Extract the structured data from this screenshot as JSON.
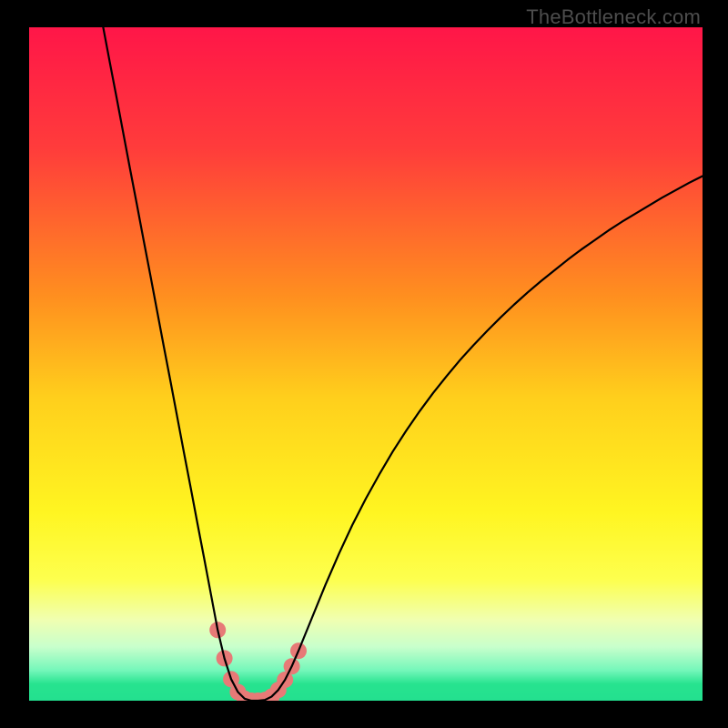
{
  "watermark": "TheBottleneck.com",
  "chart_data": {
    "type": "line",
    "title": "",
    "xlabel": "",
    "ylabel": "",
    "xlim": [
      0,
      100
    ],
    "ylim": [
      0,
      100
    ],
    "gradient_stops": [
      {
        "pos": 0.0,
        "color": "#ff1648"
      },
      {
        "pos": 0.18,
        "color": "#ff3c3b"
      },
      {
        "pos": 0.4,
        "color": "#ff8f1f"
      },
      {
        "pos": 0.55,
        "color": "#ffcf1c"
      },
      {
        "pos": 0.72,
        "color": "#fff521"
      },
      {
        "pos": 0.82,
        "color": "#fdff4e"
      },
      {
        "pos": 0.88,
        "color": "#f0ffb1"
      },
      {
        "pos": 0.92,
        "color": "#c8ffcc"
      },
      {
        "pos": 0.955,
        "color": "#74f7ba"
      },
      {
        "pos": 0.975,
        "color": "#27e38f"
      },
      {
        "pos": 1.0,
        "color": "#23e08f"
      }
    ],
    "series": [
      {
        "name": "bottleneck-curve",
        "stroke": "#000000",
        "stroke_width": 2.2,
        "x": [
          11,
          12,
          13,
          14,
          15,
          16,
          17,
          18,
          19,
          20,
          21,
          22,
          23,
          24,
          25,
          26,
          27,
          28,
          29,
          30,
          31,
          32,
          33,
          34,
          35,
          36,
          37,
          38,
          39,
          40,
          42,
          44,
          46,
          48,
          50,
          52,
          54,
          56,
          58,
          60,
          62,
          64,
          66,
          68,
          70,
          72,
          74,
          76,
          78,
          80,
          82,
          84,
          86,
          88,
          90,
          92,
          94,
          96,
          98,
          100
        ],
        "y": [
          100,
          94.7,
          89.5,
          84.2,
          78.9,
          73.7,
          68.4,
          63.2,
          57.9,
          52.6,
          47.4,
          42.1,
          36.8,
          31.6,
          26.3,
          21.1,
          15.8,
          10.5,
          6.3,
          3.2,
          1.3,
          0.3,
          0,
          0,
          0.1,
          0.6,
          1.6,
          3.1,
          5.1,
          7.4,
          12.3,
          17.2,
          21.8,
          26.1,
          30.0,
          33.6,
          37.0,
          40.1,
          43.0,
          45.7,
          48.2,
          50.6,
          52.8,
          54.9,
          56.9,
          58.8,
          60.6,
          62.3,
          63.9,
          65.5,
          67.0,
          68.4,
          69.8,
          71.1,
          72.3,
          73.5,
          74.7,
          75.8,
          76.9,
          77.9
        ]
      }
    ],
    "markers": {
      "name": "highlight-dots",
      "fill": "#e77a77",
      "radius": 9,
      "points": [
        {
          "x": 28,
          "y": 10.5
        },
        {
          "x": 29,
          "y": 6.3
        },
        {
          "x": 30,
          "y": 3.2
        },
        {
          "x": 31,
          "y": 1.3
        },
        {
          "x": 32,
          "y": 0.3
        },
        {
          "x": 33,
          "y": 0.0
        },
        {
          "x": 34,
          "y": 0.0
        },
        {
          "x": 35,
          "y": 0.1
        },
        {
          "x": 36,
          "y": 0.6
        },
        {
          "x": 37,
          "y": 1.6
        },
        {
          "x": 38,
          "y": 3.1
        },
        {
          "x": 39,
          "y": 5.1
        },
        {
          "x": 40,
          "y": 7.4
        }
      ]
    }
  }
}
